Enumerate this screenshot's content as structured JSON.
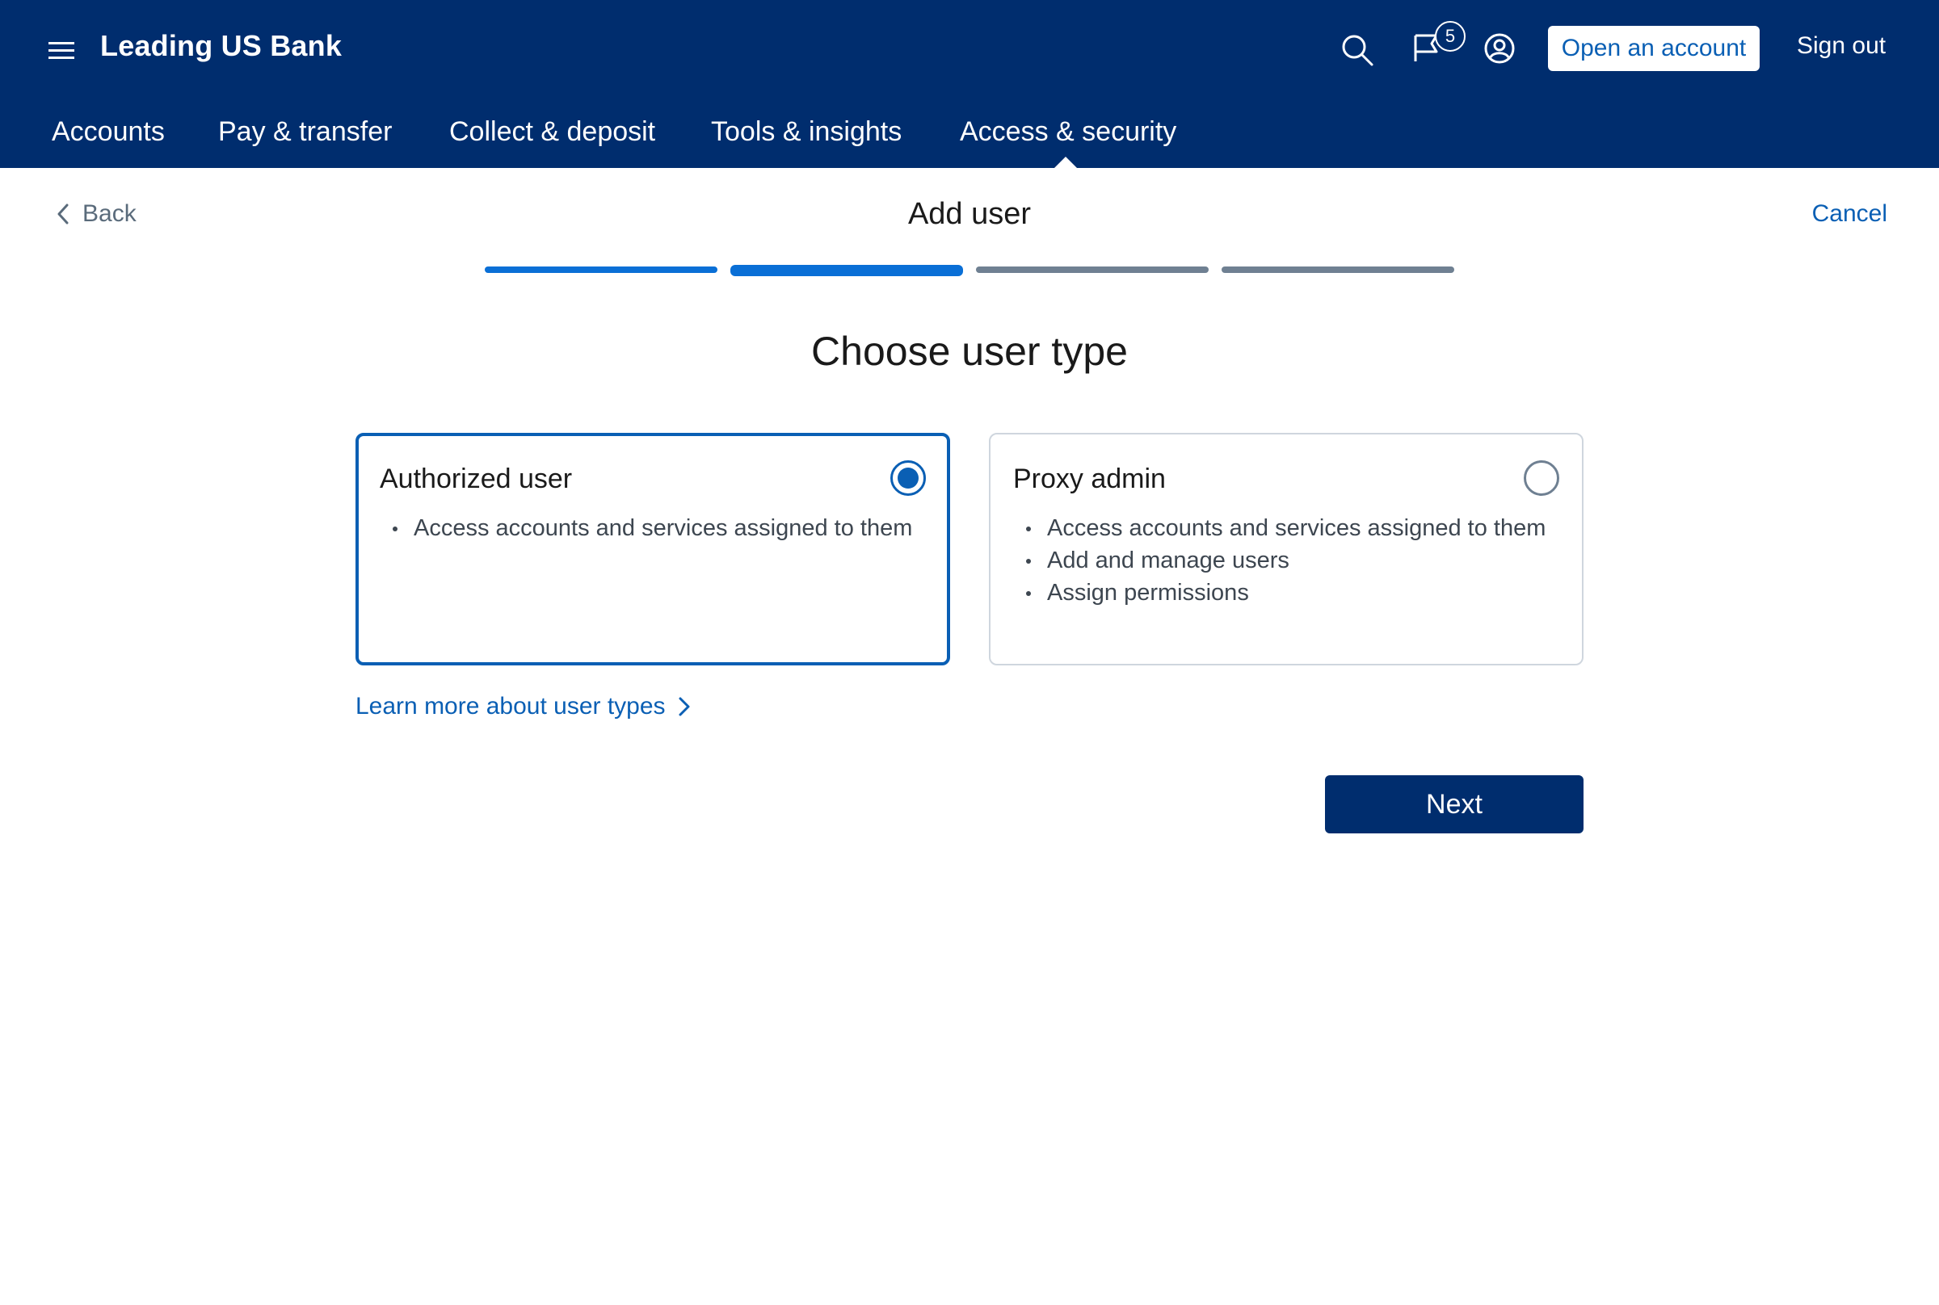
{
  "header": {
    "brand": "Leading US Bank",
    "notification_count": "5",
    "open_account_label": "Open an account",
    "sign_out_label": "Sign out"
  },
  "nav": {
    "items": [
      {
        "label": "Accounts"
      },
      {
        "label": "Pay & transfer"
      },
      {
        "label": "Collect & deposit"
      },
      {
        "label": "Tools & insights"
      },
      {
        "label": "Access & security"
      }
    ],
    "active": "Access & security"
  },
  "page": {
    "back_label": "Back",
    "title": "Add user",
    "cancel_label": "Cancel",
    "steps_total": 4,
    "current_step": 2
  },
  "content": {
    "heading": "Choose user type",
    "options": [
      {
        "title": "Authorized user",
        "selected": true,
        "bullets": [
          "Access accounts and services assigned to them"
        ]
      },
      {
        "title": "Proxy admin",
        "selected": false,
        "bullets": [
          "Access accounts and services assigned to them",
          "Add and manage users",
          "Assign permissions"
        ]
      }
    ],
    "learn_more_label": "Learn more about user types",
    "next_label": "Next"
  },
  "colors": {
    "header_bg": "#002d6e",
    "accent": "#0a5fb4",
    "progress_active": "#0a6fd6",
    "progress_inactive": "#6f8092"
  },
  "icons": [
    "menu-icon",
    "search-icon",
    "flag-icon",
    "profile-icon",
    "chevron-left-icon",
    "chevron-right-icon"
  ]
}
